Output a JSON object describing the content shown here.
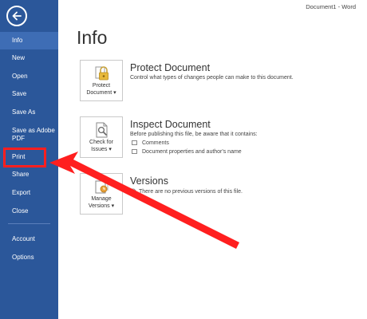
{
  "window": {
    "title": "Document1 - Word"
  },
  "sidebar": {
    "items": [
      {
        "label": "Info"
      },
      {
        "label": "New"
      },
      {
        "label": "Open"
      },
      {
        "label": "Save"
      },
      {
        "label": "Save As"
      },
      {
        "label": "Save as Adobe PDF"
      },
      {
        "label": "Print"
      },
      {
        "label": "Share"
      },
      {
        "label": "Export"
      },
      {
        "label": "Close"
      },
      {
        "label": "Account"
      },
      {
        "label": "Options"
      }
    ]
  },
  "main": {
    "title": "Info",
    "protect": {
      "button_line1": "Protect",
      "button_line2": "Document",
      "title": "Protect Document",
      "desc": "Control what types of changes people can make to this document."
    },
    "inspect": {
      "button_line1": "Check for",
      "button_line2": "Issues",
      "title": "Inspect Document",
      "desc": "Before publishing this file, be aware that it contains:",
      "bullets": [
        "Comments",
        "Document properties and author's name"
      ]
    },
    "versions": {
      "button_line1": "Manage",
      "button_line2": "Versions",
      "title": "Versions",
      "desc": "There are no previous versions of this file."
    }
  },
  "colors": {
    "sidebar": "#2b579a",
    "sidebar_selected": "#3e6db5",
    "annotation": "#ff1f1f"
  },
  "icons": [
    "back-arrow-icon",
    "lock-icon",
    "inspect-document-icon",
    "versions-icon"
  ]
}
